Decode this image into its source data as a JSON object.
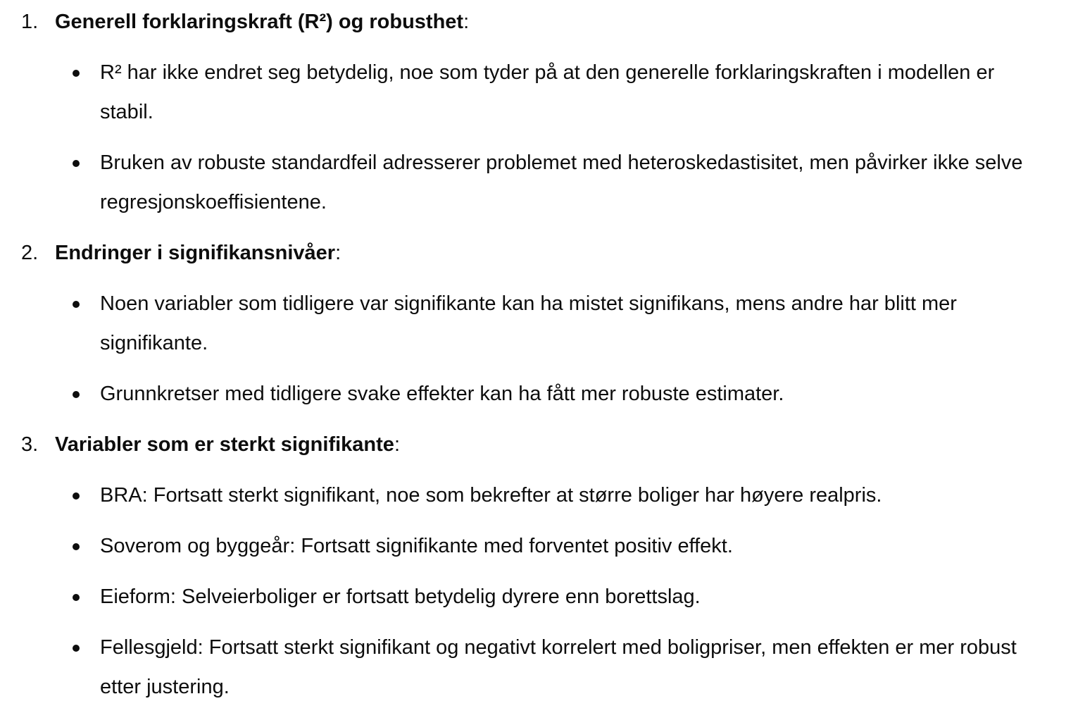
{
  "sections": [
    {
      "number": "1.",
      "title": "Generell forklaringskraft (R²) og robusthet",
      "suffix": ":",
      "bullets": [
        "R² har ikke endret seg betydelig, noe som tyder på at den generelle forklaringskraften i modellen er stabil.",
        "Bruken av robuste standardfeil adresserer problemet med heteroskedastisitet, men påvirker ikke selve regresjonskoeffisientene."
      ]
    },
    {
      "number": "2.",
      "title": "Endringer i signifikansnivåer",
      "suffix": ":",
      "bullets": [
        "Noen variabler som tidligere var signifikante kan ha mistet signifikans, mens andre har blitt mer signifikante.",
        "Grunnkretser med tidligere svake effekter kan ha fått mer robuste estimater."
      ]
    },
    {
      "number": "3.",
      "title": "Variabler som er sterkt signifikante",
      "suffix": ":",
      "bullets": [
        "BRA: Fortsatt sterkt signifikant, noe som bekrefter at større boliger har høyere realpris.",
        "Soverom og byggeår: Fortsatt signifikante med forventet positiv effekt.",
        "Eieform: Selveierboliger er fortsatt betydelig dyrere enn borettslag.",
        "Fellesgjeld: Fortsatt sterkt signifikant og negativt korrelert med boligpriser, men effekten er mer robust etter justering."
      ]
    }
  ]
}
